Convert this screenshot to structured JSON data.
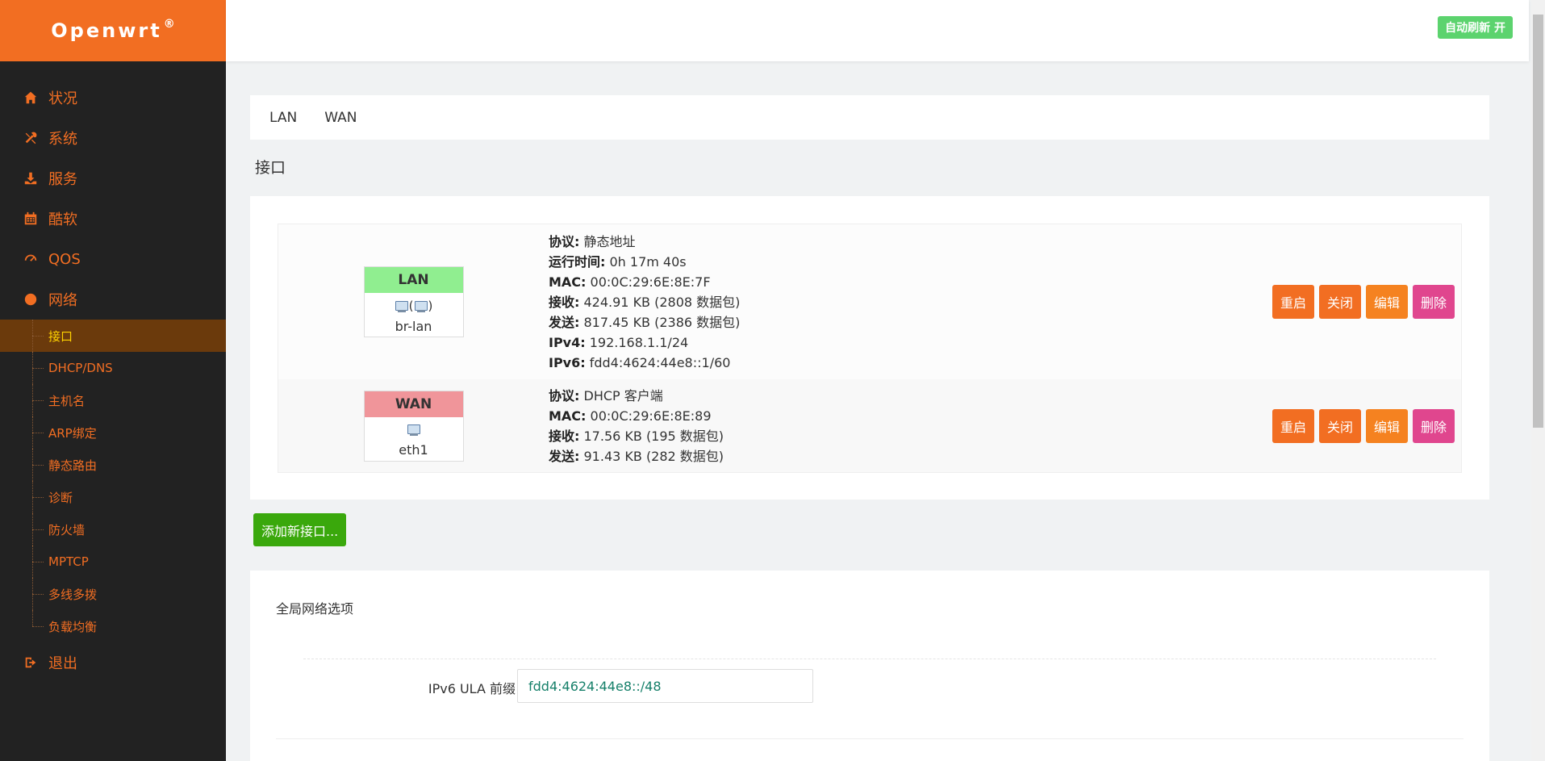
{
  "brand": {
    "name": "Openwrt",
    "mark": "®"
  },
  "sidebar": {
    "items": [
      {
        "label": "状况",
        "icon": "home-icon"
      },
      {
        "label": "系统",
        "icon": "tools-icon"
      },
      {
        "label": "服务",
        "icon": "download-icon"
      },
      {
        "label": "酷软",
        "icon": "calendar-icon"
      },
      {
        "label": "QOS",
        "icon": "gauge-icon"
      },
      {
        "label": "网络",
        "icon": "globe-icon"
      }
    ],
    "network_sub": [
      "接口",
      "DHCP/DNS",
      "主机名",
      "ARP绑定",
      "静态路由",
      "诊断",
      "防火墙",
      "MPTCP",
      "多线多拨",
      "负载均衡"
    ],
    "logout": {
      "label": "退出",
      "icon": "logout-icon"
    },
    "active_sub": "接口"
  },
  "topbar": {
    "autorefresh": "自动刷新 开"
  },
  "tabs": [
    "LAN",
    "WAN"
  ],
  "section_title": "接口",
  "interfaces": [
    {
      "name": "LAN",
      "device": "br-lan",
      "color": "#90ee90",
      "lines": [
        {
          "k": "协议:",
          "v": " 静态地址"
        },
        {
          "k": "运行时间:",
          "v": " 0h 17m 40s"
        },
        {
          "k": "MAC:",
          "v": " 00:0C:29:6E:8E:7F"
        },
        {
          "k": "接收:",
          "v": " 424.91 KB (2808 数据包)"
        },
        {
          "k": "发送:",
          "v": " 817.45 KB (2386 数据包)"
        },
        {
          "k": "IPv4:",
          "v": " 192.168.1.1/24"
        },
        {
          "k": "IPv6:",
          "v": " fdd4:4624:44e8::1/60"
        }
      ]
    },
    {
      "name": "WAN",
      "device": "eth1",
      "color": "#f0959a",
      "lines": [
        {
          "k": "协议:",
          "v": " DHCP 客户端"
        },
        {
          "k": "MAC:",
          "v": " 00:0C:29:6E:8E:89"
        },
        {
          "k": "接收:",
          "v": " 17.56 KB (195 数据包)"
        },
        {
          "k": "发送:",
          "v": " 91.43 KB (282 数据包)"
        }
      ]
    }
  ],
  "actions": {
    "restart": "重启",
    "stop": "关闭",
    "edit": "编辑",
    "delete": "删除"
  },
  "add_interface": "添加新接口...",
  "global": {
    "title": "全局网络选项",
    "ula_label": "IPv6 ULA 前缀",
    "ula_value": "fdd4:4624:44e8::/48"
  }
}
